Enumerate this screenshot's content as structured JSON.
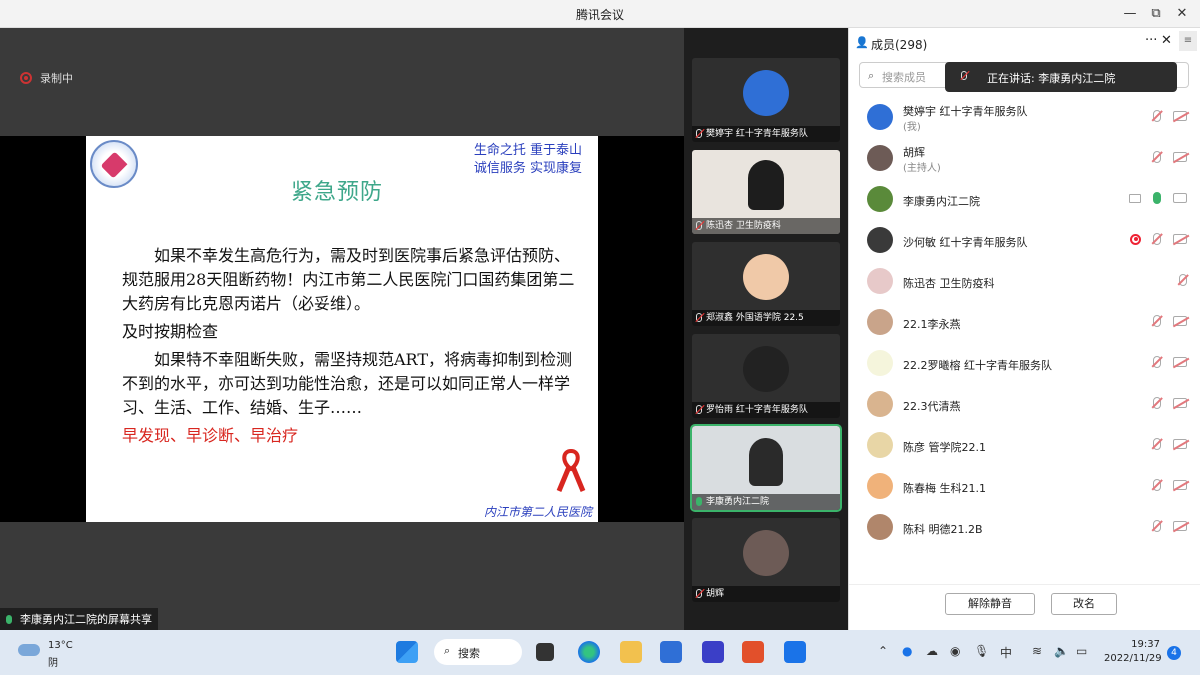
{
  "window": {
    "title": "腾讯会议",
    "minimize": "—",
    "restore": "⧉",
    "close": "✕"
  },
  "recording": {
    "label": "录制中"
  },
  "slide": {
    "title": "紧急预防",
    "slogan_line1": "生命之托    重于泰山",
    "slogan_line2": "诚信服务    实现康复",
    "para1": "如果不幸发生高危行为，需及时到医院事后紧急评估预防、规范服用28天阻断药物！内江市第二人民医院门口国药集团第二大药房有比克恩丙诺片（必妥维）。",
    "para2": "及时按期检查",
    "para3": "如果特不幸阻断失败，需坚持规范ART，将病毒抑制到检测不到的水平，亦可达到功能性治愈，还是可以如同正常人一样学习、生活、工作、结婚、生子……",
    "para4": "早发现、早诊断、早治疗",
    "footer": "内江市第二人民医院"
  },
  "share_tag": {
    "label": "李康勇内江二院的屏幕共享"
  },
  "video_tiles": [
    {
      "name": "樊婷宇 红十字青年服务队",
      "avatar_color": "#2f6fd6"
    },
    {
      "name": "陈迅杏 卫生防疫科",
      "avatar_color": "#1d1d1d"
    },
    {
      "name": "郑淑鑫 外国语学院 22.5",
      "avatar_color": "#f0c9a8"
    },
    {
      "name": "罗怡雨 红十字青年服务队",
      "avatar_color": "#222222"
    },
    {
      "name": "李康勇内江二院",
      "avatar_color": "#2a2a2a"
    },
    {
      "name": "胡辉",
      "avatar_color": "#6d5b56"
    }
  ],
  "panel": {
    "title": "成员(298)",
    "more": "···",
    "close": "✕",
    "side": "≡",
    "search_placeholder": "搜索成员",
    "speaking": "正在讲话: 李康勇内江二院",
    "mute_all": "解除静音",
    "rename": "改名"
  },
  "members": [
    {
      "name": "樊婷宇 红十字青年服务队",
      "role": "(我)",
      "avatar_color": "#2f6fd6",
      "mic": "muted",
      "cam": "muted",
      "rec": false,
      "screen": false
    },
    {
      "name": "胡辉",
      "role": "(主持人)",
      "avatar_color": "#6d5b56",
      "mic": "muted",
      "cam": "muted",
      "rec": false,
      "screen": false
    },
    {
      "name": "李康勇内江二院",
      "role": "",
      "avatar_color": "#5a8a3a",
      "mic": "on",
      "cam": "normal",
      "rec": false,
      "screen": true
    },
    {
      "name": "沙何敏 红十字青年服务队",
      "role": "",
      "avatar_color": "#3a3a3a",
      "mic": "muted",
      "cam": "muted",
      "rec": true,
      "screen": false
    },
    {
      "name": "陈迅杏 卫生防疫科",
      "role": "",
      "avatar_color": "#e7c9c9",
      "mic": "muted",
      "cam": "none",
      "rec": false,
      "screen": false
    },
    {
      "name": "22.1李永燕",
      "role": "",
      "avatar_color": "#c9a48a",
      "mic": "muted",
      "cam": "muted",
      "rec": false,
      "screen": false
    },
    {
      "name": "22.2罗曦榕 红十字青年服务队",
      "role": "",
      "avatar_color": "#f5f5dc",
      "mic": "muted",
      "cam": "muted",
      "rec": false,
      "screen": false
    },
    {
      "name": "22.3代清燕",
      "role": "",
      "avatar_color": "#d9b48f",
      "mic": "muted",
      "cam": "muted",
      "rec": false,
      "screen": false
    },
    {
      "name": "陈彦 管学院22.1",
      "role": "",
      "avatar_color": "#e8d6a6",
      "mic": "muted",
      "cam": "muted",
      "rec": false,
      "screen": false
    },
    {
      "name": "陈春梅 生科21.1",
      "role": "",
      "avatar_color": "#f0b27a",
      "mic": "muted",
      "cam": "muted",
      "rec": false,
      "screen": false
    },
    {
      "name": "陈科 明德21.2B",
      "role": "",
      "avatar_color": "#b0866b",
      "mic": "muted",
      "cam": "muted",
      "rec": false,
      "screen": false
    }
  ],
  "taskbar": {
    "weather_temp": "13°C",
    "weather_desc": "阴",
    "search": "搜索",
    "ime": "中",
    "time": "19:37",
    "date": "2022/11/29",
    "notifications": "4"
  }
}
